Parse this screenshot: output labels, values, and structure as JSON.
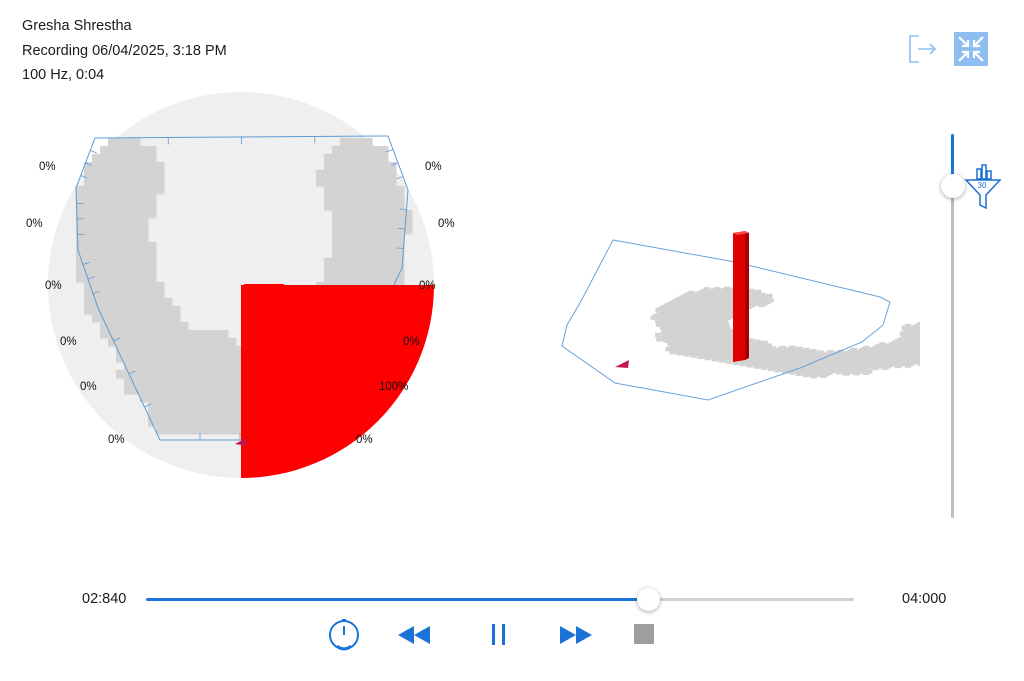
{
  "header": {
    "patient_name": "Gresha  Shrestha",
    "recording_label": "Recording 06/04/2025, 3:18 PM",
    "rate_duration": "100 Hz, 0:04"
  },
  "icons": {
    "exit": "exit-icon",
    "collapse": "collapse-icon",
    "filter": "filter-icon",
    "timer": "timer-icon",
    "rewind": "rewind-icon",
    "pause": "pause-icon",
    "fast_forward": "fast-forward-icon",
    "stop": "stop-icon"
  },
  "pressure_map": {
    "left_labels": [
      "0%",
      "0%",
      "0%",
      "0%",
      "0%",
      "0%"
    ],
    "right_labels": [
      "0%",
      "0%",
      "0%",
      "0%",
      "100%",
      "0%"
    ]
  },
  "zoom": {
    "filter_value": "30",
    "level": 0.07
  },
  "playback": {
    "current_time": "02:840",
    "total_time": "04:000",
    "progress": 0.709
  },
  "colors": {
    "accent": "#1a73d9",
    "pressure": "#ff0000",
    "sensor": "#d3d3d3",
    "outline": "#5b9bd5",
    "disc": "#efefef",
    "stop": "#9e9e9e"
  }
}
